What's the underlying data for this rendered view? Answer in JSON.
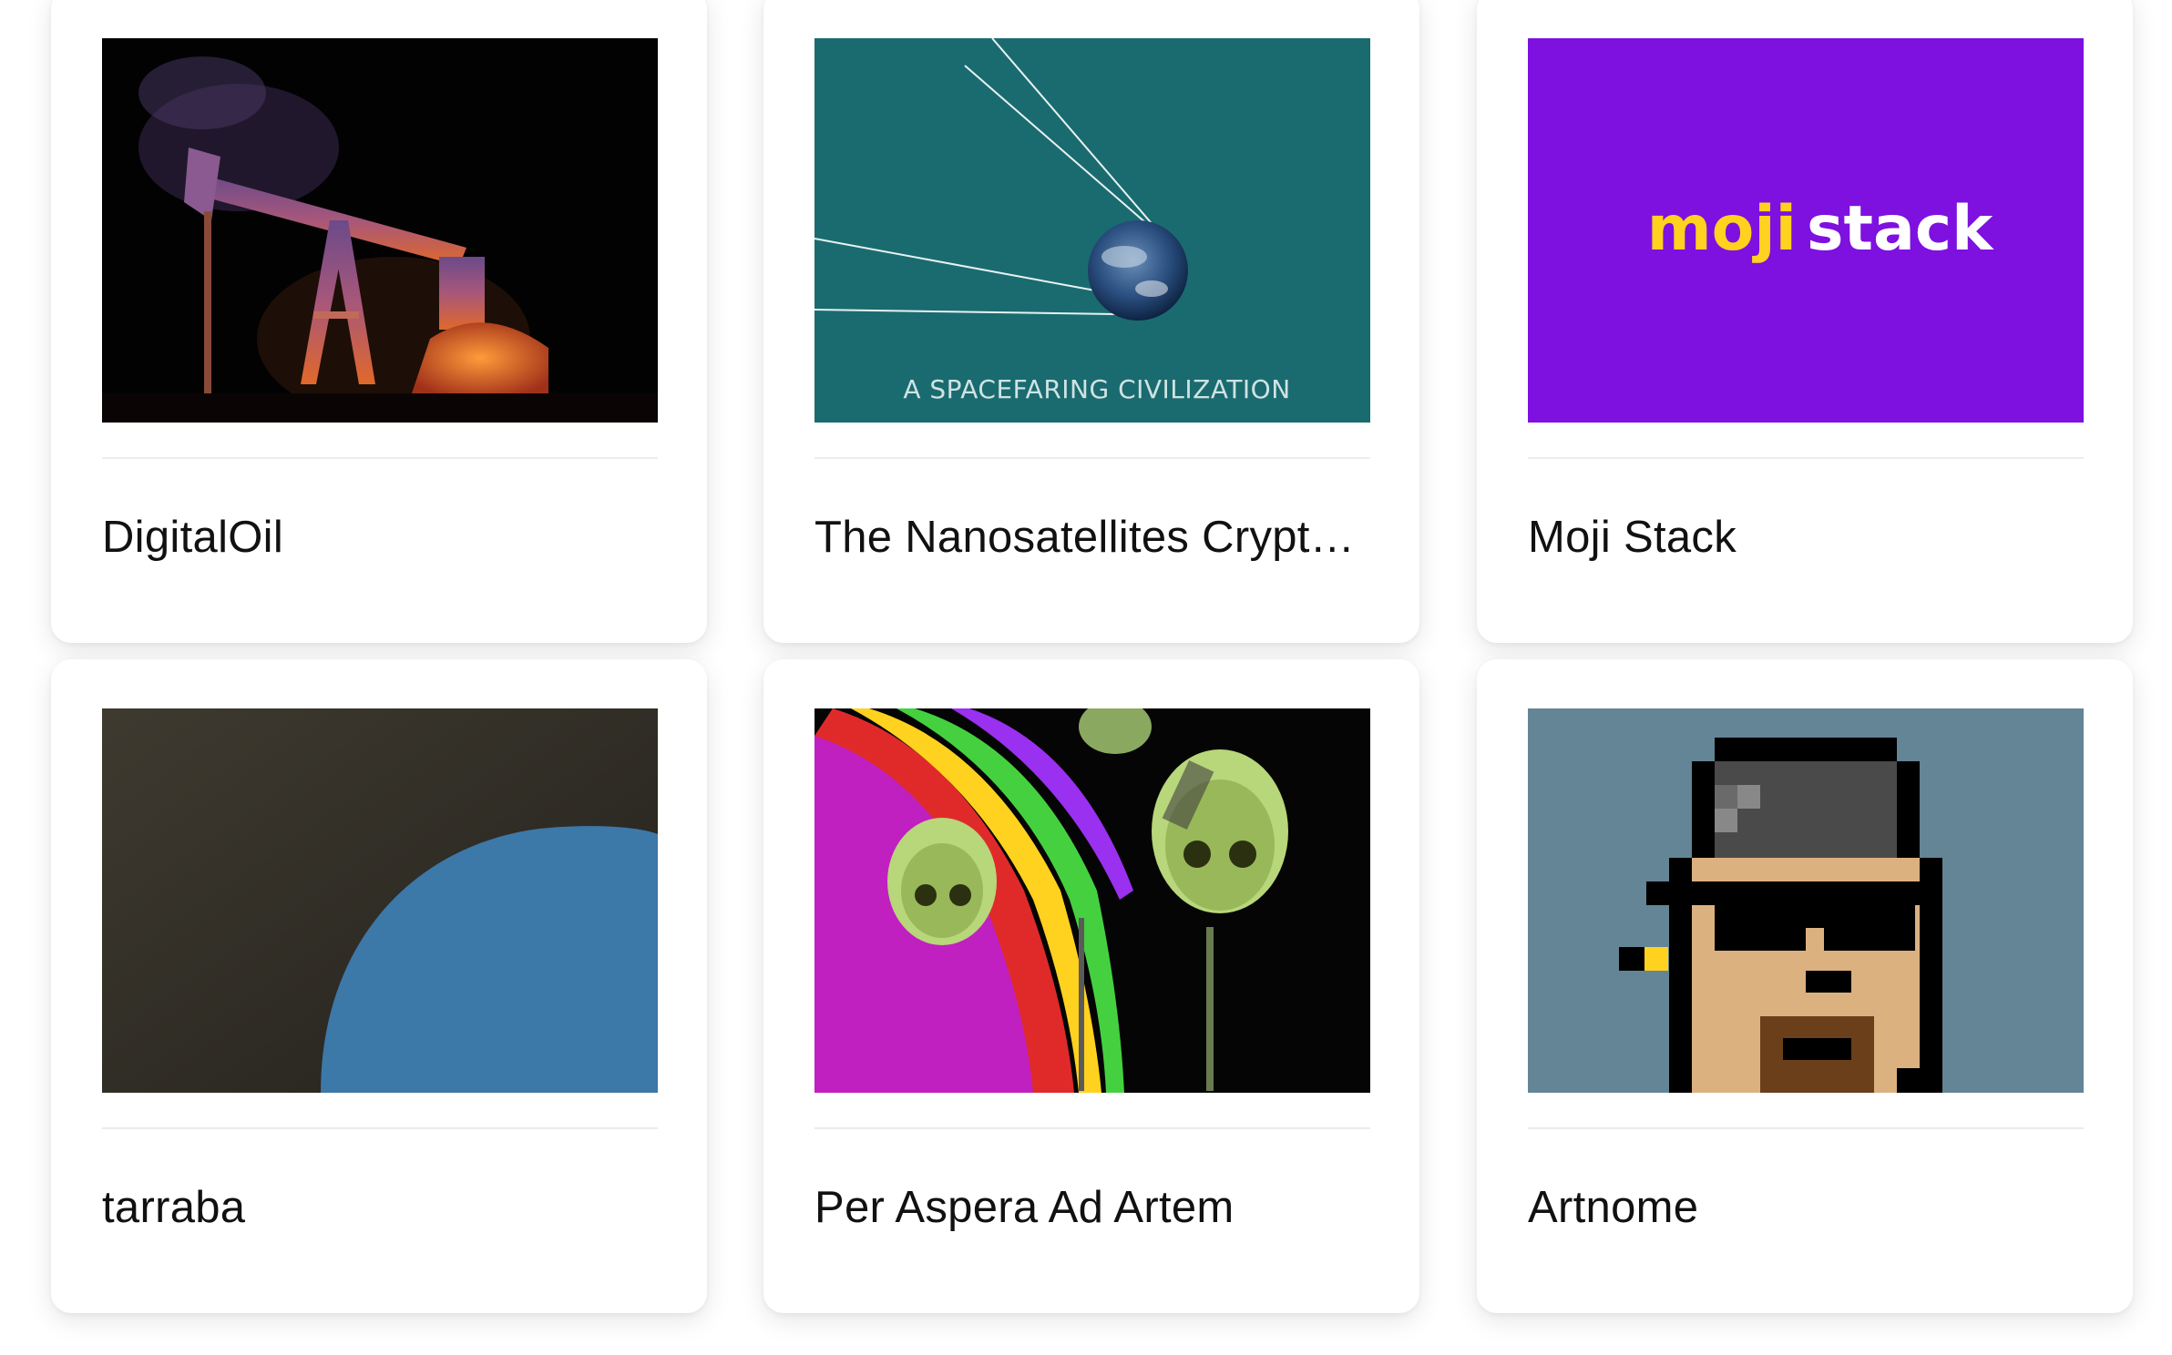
{
  "projects": [
    {
      "title": "DigitalOil",
      "image": "oil-pump-jack-artwork"
    },
    {
      "title": "The Nanosatellites Crypto…",
      "image": "satellite-earth-artwork",
      "image_caption": "A SPACEFARING CIVILIZATION"
    },
    {
      "title": "Moji Stack",
      "image": "moji-stack-logo",
      "logo_text_a": "moji",
      "logo_text_b": "stack"
    },
    {
      "title": "tarraba",
      "image": "blue-circle-painting"
    },
    {
      "title": "Per Aspera Ad Artem",
      "image": "neon-skulls-artwork"
    },
    {
      "title": "Artnome",
      "image": "pixel-punk-avatar"
    }
  ],
  "colors": {
    "moji_purple": "#7e10e0",
    "moji_yellow": "#ffd21f",
    "teal": "#1a6b70",
    "punk_bg": "#638596"
  }
}
